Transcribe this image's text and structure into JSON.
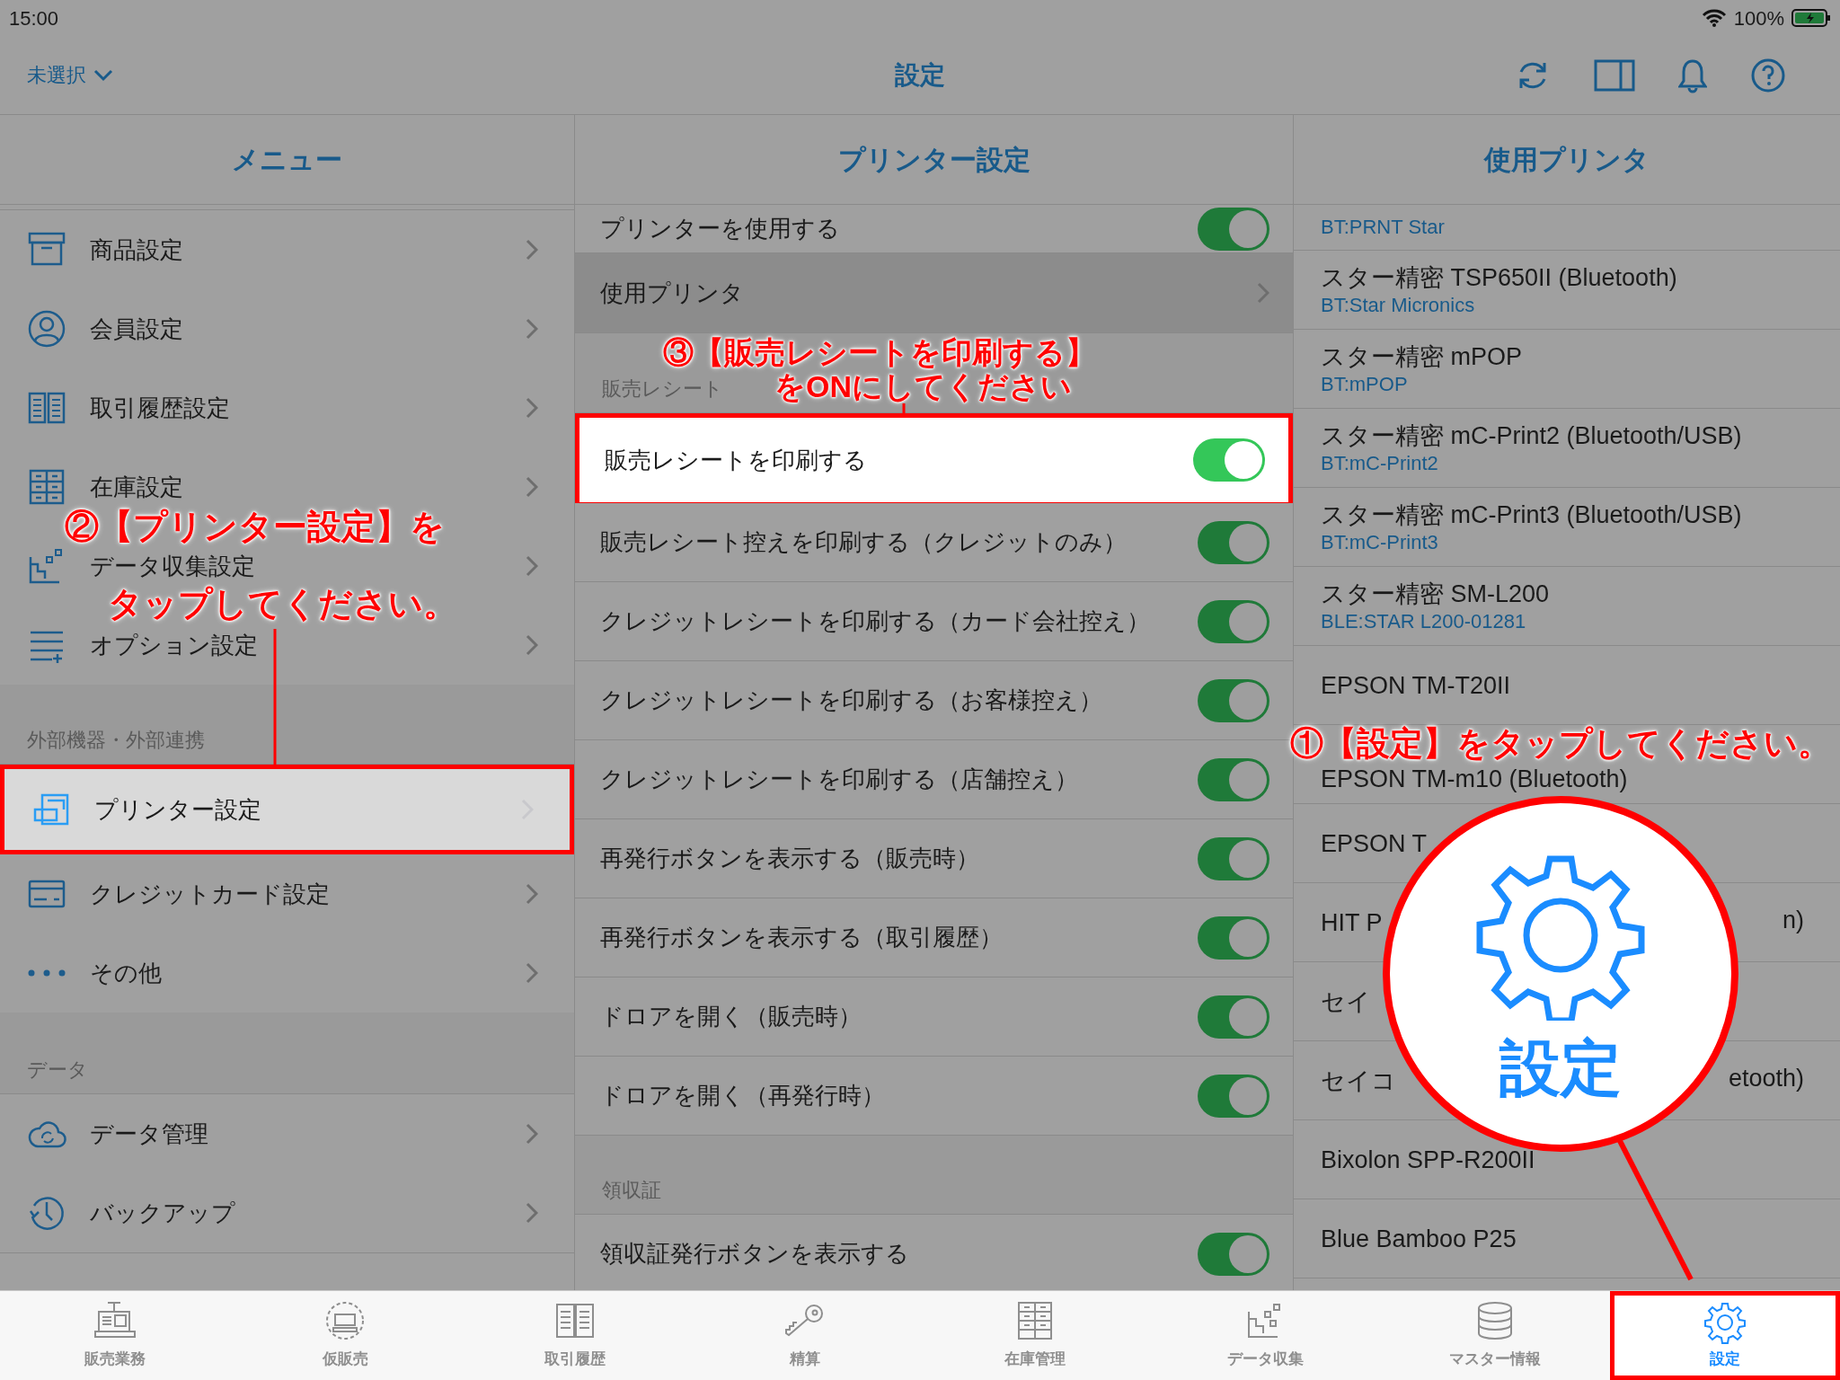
{
  "status_bar": {
    "time": "15:00",
    "battery": "100%"
  },
  "nav_bar": {
    "store_picker": "未選択",
    "title": "設定"
  },
  "menu": {
    "header": "メニュー",
    "sections": [
      {
        "items": [
          {
            "label": "商品設定",
            "selected": false,
            "highlighted": false
          },
          {
            "label": "会員設定",
            "selected": false,
            "highlighted": false
          },
          {
            "label": "取引履歴設定",
            "selected": false,
            "highlighted": false
          },
          {
            "label": "在庫設定",
            "selected": false,
            "highlighted": false
          },
          {
            "label": "データ収集設定",
            "selected": false,
            "highlighted": false
          },
          {
            "label": "オプション設定",
            "selected": false,
            "highlighted": false
          }
        ]
      },
      {
        "header": "外部機器・外部連携",
        "items": [
          {
            "label": "プリンター設定",
            "selected": true,
            "highlighted": true
          },
          {
            "label": "クレジットカード設定",
            "selected": false,
            "highlighted": false
          },
          {
            "label": "その他",
            "selected": false,
            "highlighted": false
          }
        ]
      },
      {
        "header": "データ",
        "items": [
          {
            "label": "データ管理",
            "selected": false,
            "highlighted": false
          },
          {
            "label": "バックアップ",
            "selected": false,
            "highlighted": false
          }
        ]
      }
    ]
  },
  "printer_settings": {
    "header": "プリンター設定",
    "sections": [
      {
        "rows": [
          {
            "kind": "toggle",
            "label": "プリンターを使用する",
            "on": true,
            "highlighted": false
          },
          {
            "kind": "link",
            "label": "使用プリンタ",
            "selected": true,
            "highlighted": false
          }
        ]
      },
      {
        "header": "販売レシート",
        "rows": [
          {
            "kind": "toggle",
            "label": "販売レシートを印刷する",
            "on": true,
            "highlighted": true
          },
          {
            "kind": "toggle",
            "label": "販売レシート控えを印刷する（クレジットのみ）",
            "on": true,
            "highlighted": false
          },
          {
            "kind": "toggle",
            "label": "クレジットレシートを印刷する（カード会社控え）",
            "on": true,
            "highlighted": false
          },
          {
            "kind": "toggle",
            "label": "クレジットレシートを印刷する（お客様控え）",
            "on": true,
            "highlighted": false
          },
          {
            "kind": "toggle",
            "label": "クレジットレシートを印刷する（店舗控え）",
            "on": true,
            "highlighted": false
          },
          {
            "kind": "toggle",
            "label": "再発行ボタンを表示する（販売時）",
            "on": true,
            "highlighted": false
          },
          {
            "kind": "toggle",
            "label": "再発行ボタンを表示する（取引履歴）",
            "on": true,
            "highlighted": false
          },
          {
            "kind": "toggle",
            "label": "ドロアを開く（販売時）",
            "on": true,
            "highlighted": false
          },
          {
            "kind": "toggle",
            "label": "ドロアを開く（再発行時）",
            "on": true,
            "highlighted": false
          }
        ]
      },
      {
        "header": "領収証",
        "rows": [
          {
            "kind": "toggle",
            "label": "領収証発行ボタンを表示する",
            "on": true,
            "highlighted": false
          }
        ]
      }
    ]
  },
  "used_printers": {
    "header": "使用プリンタ",
    "items": [
      {
        "address": "BT:PRNT Star"
      },
      {
        "name": "スター精密 TSP650II (Bluetooth)",
        "address": "BT:Star Micronics"
      },
      {
        "name": "スター精密 mPOP",
        "address": "BT:mPOP"
      },
      {
        "name": "スター精密 mC-Print2 (Bluetooth/USB)",
        "address": "BT:mC-Print2"
      },
      {
        "name": "スター精密 mC-Print3 (Bluetooth/USB)",
        "address": "BT:mC-Print3"
      },
      {
        "name": "スター精密 SM-L200",
        "address": "BLE:STAR L200-01281"
      },
      {
        "name": "EPSON TM-T20II"
      },
      {
        "name": "EPSON TM-m10 (Bluetooth)"
      },
      {
        "name": "EPSON T"
      },
      {
        "name": "HIT P",
        "tail": "n)"
      },
      {
        "name": "セイ"
      },
      {
        "name": "セイコ",
        "tail": "etooth)"
      },
      {
        "name": "Bixolon SPP-R200II"
      },
      {
        "name": "Blue Bamboo P25"
      }
    ]
  },
  "tab_bar": {
    "tabs": [
      {
        "label": "販売業務",
        "selected": false,
        "highlighted": false
      },
      {
        "label": "仮販売",
        "selected": false,
        "highlighted": false
      },
      {
        "label": "取引履歴",
        "selected": false,
        "highlighted": false
      },
      {
        "label": "精算",
        "selected": false,
        "highlighted": false
      },
      {
        "label": "在庫管理",
        "selected": false,
        "highlighted": false
      },
      {
        "label": "データ収集",
        "selected": false,
        "highlighted": false
      },
      {
        "label": "マスター情報",
        "selected": false,
        "highlighted": false
      },
      {
        "label": "設定",
        "selected": true,
        "highlighted": true
      }
    ]
  },
  "callouts": [
    {
      "lines": [
        "①【設定】をタップしてください。"
      ]
    },
    {
      "lines": [
        "②【プリンター設定】を",
        "タップしてください。"
      ]
    },
    {
      "lines": [
        "③【販売レシートを印刷する】",
        "をONにしてください"
      ]
    }
  ],
  "magnifier": {
    "label": "設定"
  }
}
